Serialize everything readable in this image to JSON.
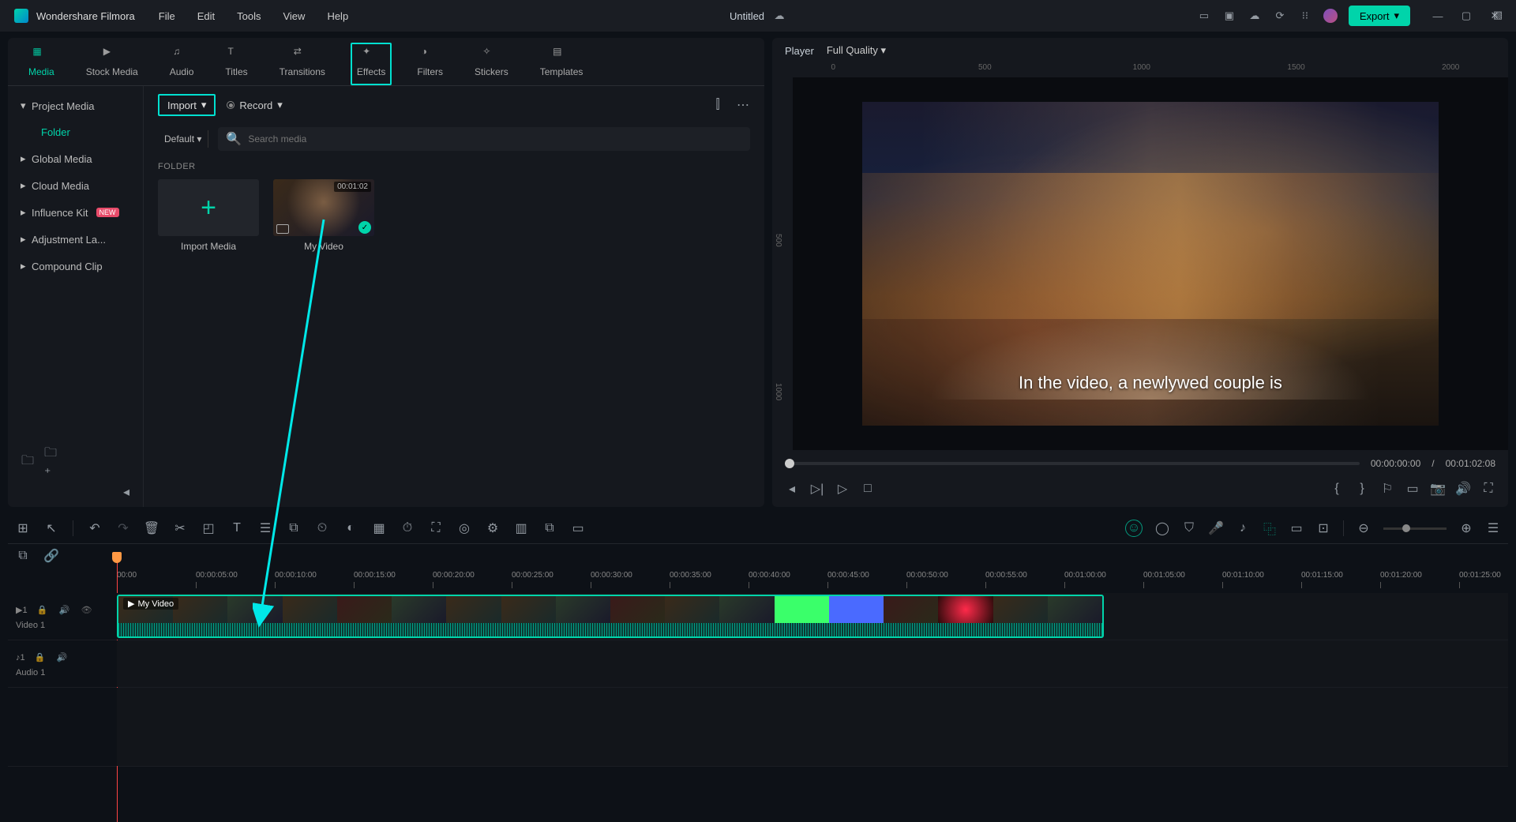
{
  "app": {
    "name": "Wondershare Filmora",
    "doc_title": "Untitled"
  },
  "menu": [
    "File",
    "Edit",
    "Tools",
    "View",
    "Help"
  ],
  "export_label": "Export",
  "tabs": [
    {
      "id": "media",
      "label": "Media",
      "active": true
    },
    {
      "id": "stock",
      "label": "Stock Media"
    },
    {
      "id": "audio",
      "label": "Audio"
    },
    {
      "id": "titles",
      "label": "Titles"
    },
    {
      "id": "transitions",
      "label": "Transitions"
    },
    {
      "id": "effects",
      "label": "Effects",
      "highlighted": true
    },
    {
      "id": "filters",
      "label": "Filters"
    },
    {
      "id": "stickers",
      "label": "Stickers"
    },
    {
      "id": "templates",
      "label": "Templates"
    }
  ],
  "sidebar": {
    "items": [
      {
        "label": "Project Media"
      },
      {
        "label": "Folder",
        "active": true,
        "indent": true
      },
      {
        "label": "Global Media"
      },
      {
        "label": "Cloud Media"
      },
      {
        "label": "Influence Kit",
        "badge": "NEW"
      },
      {
        "label": "Adjustment La..."
      },
      {
        "label": "Compound Clip"
      }
    ]
  },
  "import_label": "Import",
  "record_label": "Record",
  "sort_label": "Default",
  "search_placeholder": "Search media",
  "folder_heading": "FOLDER",
  "thumbs": {
    "import_media": "Import Media",
    "video": {
      "name": "My Video",
      "duration": "00:01:02"
    }
  },
  "player": {
    "title": "Player",
    "quality": "Full Quality",
    "caption": "In the video, a newlywed couple is",
    "current": "00:00:00:00",
    "total": "00:01:02:08",
    "ruler_marks": [
      "0",
      "500",
      "1000",
      "1500",
      "2000"
    ],
    "ruler_left": [
      "500",
      "1000"
    ]
  },
  "timeline": {
    "marks": [
      "00:00",
      "00:00:05:00",
      "00:00:10:00",
      "00:00:15:00",
      "00:00:20:00",
      "00:00:25:00",
      "00:00:30:00",
      "00:00:35:00",
      "00:00:40:00",
      "00:00:45:00",
      "00:00:50:00",
      "00:00:55:00",
      "00:01:00:00",
      "00:01:05:00",
      "00:01:10:00",
      "00:01:15:00",
      "00:01:20:00",
      "00:01:25:00"
    ],
    "tracks": {
      "video": {
        "label": "Video 1",
        "clip_name": "My Video"
      },
      "audio": {
        "label": "Audio 1"
      }
    },
    "separator": "/"
  }
}
